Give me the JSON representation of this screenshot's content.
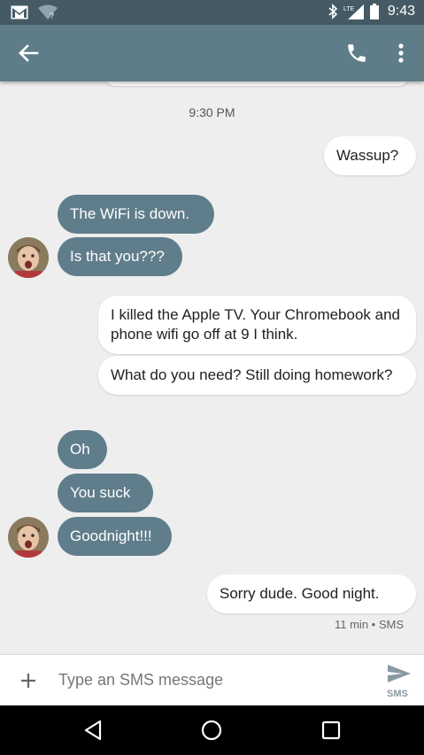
{
  "status_bar": {
    "time": "9:43",
    "network": "LTE",
    "icons": [
      "gmail-icon",
      "wifi-icon",
      "bluetooth-icon",
      "signal-icon",
      "battery-icon"
    ]
  },
  "app_bar": {
    "icons": [
      "arrow-back-icon",
      "phone-icon",
      "more-vert-icon"
    ]
  },
  "conversation": {
    "timestamp": "9:30 PM",
    "messages": [
      {
        "direction": "out",
        "text": "Wassup?"
      },
      {
        "direction": "in",
        "text": "The WiFi is down."
      },
      {
        "direction": "in",
        "text": "Is that you???"
      },
      {
        "direction": "out",
        "text": "I killed the Apple TV.  Your Chromebook and phone wifi go off at 9 I think."
      },
      {
        "direction": "out",
        "text": "What do you need?  Still doing homework?"
      },
      {
        "direction": "in",
        "text": "Oh"
      },
      {
        "direction": "in",
        "text": "You suck"
      },
      {
        "direction": "in",
        "text": "Goodnight!!!"
      },
      {
        "direction": "out",
        "text": "Sorry dude.  Good night."
      }
    ],
    "last_meta": "11 min • SMS"
  },
  "compose": {
    "placeholder": "Type an SMS message",
    "send_label": "SMS"
  },
  "colors": {
    "status_bar": "#455a64",
    "app_bar": "#5f7d89",
    "incoming_bubble": "#607d8b",
    "outgoing_bubble": "#ffffff",
    "background": "#eeeeee"
  }
}
